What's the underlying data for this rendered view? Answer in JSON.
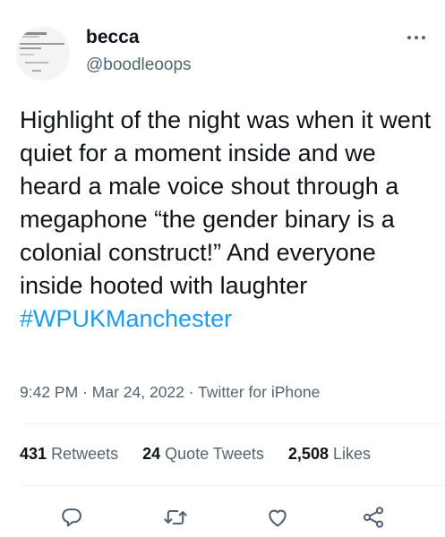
{
  "user": {
    "display_name": "becca",
    "handle": "@boodleoops"
  },
  "tweet": {
    "text": "Highlight of the night was when it went quiet for a moment inside and we heard a male voice shout through a megaphone “the gender binary is a colonial construct!” And everyone inside hooted with laughter",
    "hashtag": "#WPUKManchester"
  },
  "meta": {
    "time": "9:42 PM",
    "separator": "·",
    "date": "Mar 24, 2022",
    "source": "Twitter for iPhone"
  },
  "stats": {
    "retweets_count": "431",
    "retweets_label": "Retweets",
    "quote_tweets_count": "24",
    "quote_tweets_label": "Quote Tweets",
    "likes_count": "2,508",
    "likes_label": "Likes"
  },
  "icons": {
    "more": "more-horizontal-icon",
    "reply": "reply-icon",
    "retweet": "retweet-icon",
    "like": "heart-icon",
    "share": "share-icon"
  },
  "colors": {
    "text": "#0f1419",
    "secondary": "#536471",
    "link": "#1d9bf0",
    "divider": "#eff3f4"
  }
}
